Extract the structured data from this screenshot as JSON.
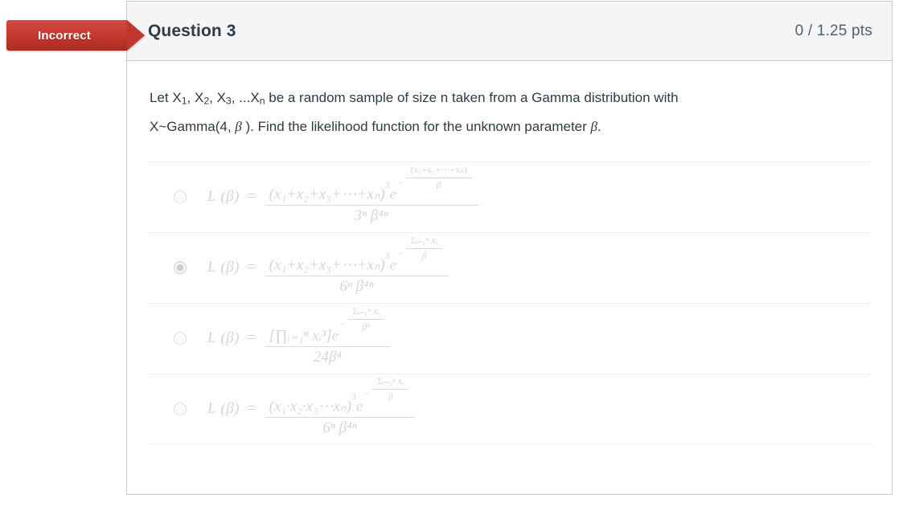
{
  "status_flag": {
    "label": "Incorrect",
    "color": "#c63a30"
  },
  "header": {
    "title": "Question 3",
    "points": "0 / 1.25 pts",
    "points_earned": "0",
    "points_possible": "1.25",
    "points_unit": "pts"
  },
  "question": {
    "line1_a": "Let X",
    "line1_sub1": "1",
    "line1_b": ", X",
    "line1_sub2": "2",
    "line1_c": ", X",
    "line1_sub3": "3",
    "line1_d": ", ...X",
    "line1_sub4": "n",
    "line1_e": " be a random sample of size n taken from a Gamma distribution with",
    "line2_a": "X~Gamma(4, ",
    "line2_beta": "β",
    "line2_b": " ).  Find the likelihood function for the unknown parameter ",
    "line2_beta2": "β",
    "line2_c": "."
  },
  "answers": [
    {
      "id": "option-a",
      "selected": false,
      "lhs": "L",
      "lhs_arg": "(β)",
      "eq": "=",
      "numerator_base": "(x₁+x₂+x₃+⋯+xₙ)",
      "numerator_power": "3",
      "exp_base": "e",
      "exp_sign": "−",
      "exp_numerator": "(x₁+x₂+⋯+xₙ)",
      "exp_denominator": "β",
      "denominator": "3ⁿ β⁴ⁿ",
      "latex": "L(\\beta)=\\frac{(x_1+x_2+x_3+\\cdots+x_n)^3 e^{-\\frac{(x_1+x_2+\\cdots+x_n)}{\\beta}}}{3^n\\beta^{4n}}"
    },
    {
      "id": "option-b",
      "selected": true,
      "lhs": "L",
      "lhs_arg": "(β)",
      "eq": "=",
      "numerator_base": "(x₁+x₂+x₃+⋯+xₙ)",
      "numerator_power": "3",
      "exp_base": "e",
      "exp_sign": "−",
      "exp_numerator": "Σᵢ₌₁ⁿ xᵢ",
      "exp_denominator": "β",
      "denominator": "6ⁿ β⁴ⁿ",
      "latex": "L(\\beta)=\\frac{(x_1+x_2+x_3+\\cdots+x_n)^3 e^{-\\frac{\\sum_{i=1}^{n} x_i}{\\beta}}}{6^n\\beta^{4n}}"
    },
    {
      "id": "option-c",
      "selected": false,
      "lhs": "L",
      "lhs_arg": "(β)",
      "eq": "=",
      "numerator_base": "[∏ᵢ₌₁ⁿ xᵢ³]",
      "numerator_power": "",
      "exp_base": "e",
      "exp_sign": "−",
      "exp_numerator": "Σᵢ₌₁ⁿ xᵢ",
      "exp_denominator": "βⁿ",
      "denominator": "24β⁴",
      "latex": "L(\\beta)=\\frac{[\\prod_{i=1}^{n} x_i^3] e^{-\\frac{\\sum_{i=1}^{n} x_i}{\\beta^n}}}{24\\beta^4}"
    },
    {
      "id": "option-d",
      "selected": false,
      "lhs": "L",
      "lhs_arg": "(β)",
      "eq": "=",
      "numerator_base": "(x₁·x₂·x₃⋯xₙ)",
      "numerator_power": "3",
      "exp_base": "e",
      "exp_sign": "−",
      "exp_numerator": "Σᵢ₌₁ⁿ xᵢ",
      "exp_denominator": "β",
      "denominator": "6ⁿ β⁴ⁿ",
      "latex": "L(\\beta)=\\frac{(x_1\\cdot x_2\\cdot x_3\\cdots x_n)^3 e^{-\\frac{\\sum_{i=1}^{n} x_i}{\\beta}}}{6^n\\beta^{4n}}"
    }
  ]
}
